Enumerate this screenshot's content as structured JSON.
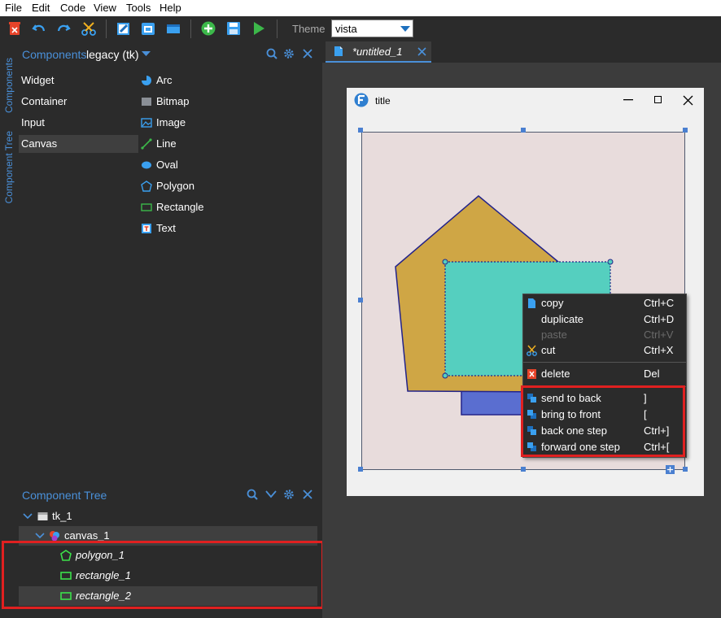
{
  "menubar": {
    "file": "File",
    "edit": "Edit",
    "code": "Code",
    "view": "View",
    "tools": "Tools",
    "help": "Help"
  },
  "toolbar": {
    "theme_label": "Theme",
    "theme_value": "vista"
  },
  "side_tabs": {
    "components": "Components",
    "component_tree": "Component Tree"
  },
  "components": {
    "title": "Components",
    "library": "legacy (tk)",
    "categories": [
      "Widget",
      "Container",
      "Input",
      "Canvas"
    ],
    "items": [
      "Arc",
      "Bitmap",
      "Image",
      "Line",
      "Oval",
      "Polygon",
      "Rectangle",
      "Text"
    ]
  },
  "tree": {
    "title": "Component Tree",
    "root": "tk_1",
    "canvas": "canvas_1",
    "children": [
      "polygon_1",
      "rectangle_1",
      "rectangle_2"
    ]
  },
  "editor": {
    "tab_label": "*untitled_1"
  },
  "window": {
    "title": "title"
  },
  "context_menu": {
    "items": [
      {
        "label": "copy",
        "shortcut": "Ctrl+C"
      },
      {
        "label": "duplicate",
        "shortcut": "Ctrl+D"
      },
      {
        "label": "paste",
        "shortcut": "Ctrl+V"
      },
      {
        "label": "cut",
        "shortcut": "Ctrl+X"
      },
      {
        "label": "delete",
        "shortcut": "Del"
      },
      {
        "label": "send to back",
        "shortcut": "]"
      },
      {
        "label": "bring to front",
        "shortcut": "["
      },
      {
        "label": "back one step",
        "shortcut": "Ctrl+]"
      },
      {
        "label": "forward one step",
        "shortcut": "Ctrl+["
      }
    ]
  },
  "colors": {
    "accent": "#4a90d9",
    "polygon_fill": "#cfa645",
    "rect_teal": "#55cfbf",
    "rect_blue": "#5a6ed0",
    "canvas_bg": "#e8dcdc",
    "highlight": "#e02020"
  }
}
